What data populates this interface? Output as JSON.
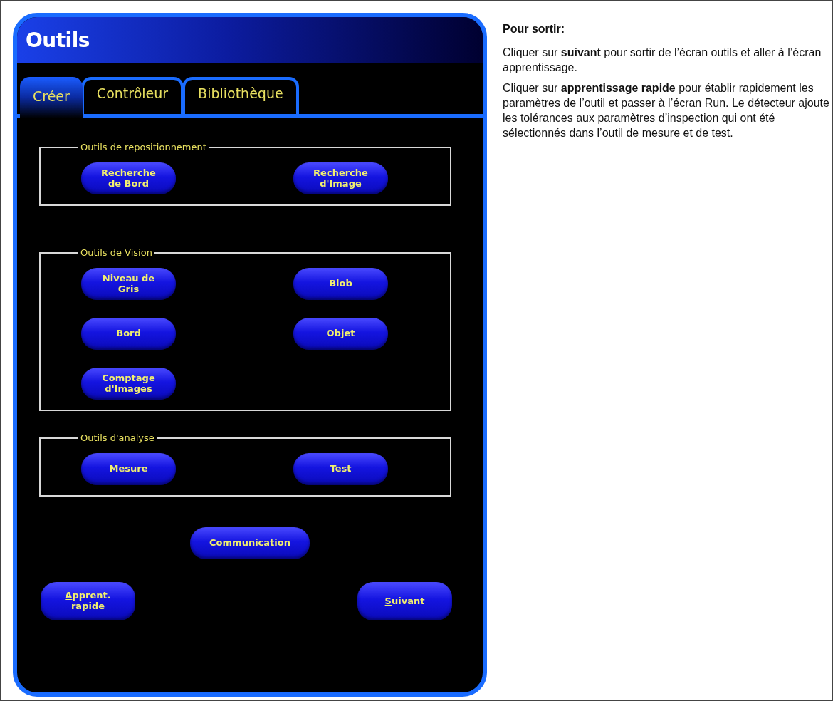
{
  "window": {
    "title": "Outils"
  },
  "tabs": [
    {
      "label": "Créer",
      "selected": true
    },
    {
      "label": "Contrôleur",
      "selected": false
    },
    {
      "label": "Bibliothèque",
      "selected": false
    }
  ],
  "groups": [
    {
      "title": "Outils de repositionnement",
      "buttons": [
        {
          "label": "Recherche\nde Bord"
        },
        {
          "label": "Recherche\nd'Image"
        }
      ]
    },
    {
      "title": "Outils de Vision",
      "buttons": [
        {
          "label": "Niveau de\nGris"
        },
        {
          "label": "Blob"
        },
        {
          "label": "Bord"
        },
        {
          "label": "Objet"
        },
        {
          "label": "Comptage\nd'Images"
        }
      ]
    },
    {
      "title": "Outils d'analyse",
      "buttons": [
        {
          "label": "Mesure"
        },
        {
          "label": "Test"
        }
      ]
    }
  ],
  "footer": [
    {
      "label": "Communication",
      "mnemonic": false
    },
    {
      "label": "Apprent.\nrapide",
      "mnemonic": true
    },
    {
      "label": "Suivant",
      "mnemonic": true
    }
  ],
  "help": {
    "heading": "Pour sortir:",
    "paragraphs": [
      "Cliquer sur **suivant** pour sortir de l’écran outils et aller à l’écran apprentissage.",
      "Cliquer sur **apprentissage rapide** pour établir rapidement les paramètres de l’outil et passer à l’écran Run. Le détecteur ajoute les tolérances aux paramètres d’inspection qui ont été sélectionnés dans l’outil de mesure et de test."
    ]
  }
}
